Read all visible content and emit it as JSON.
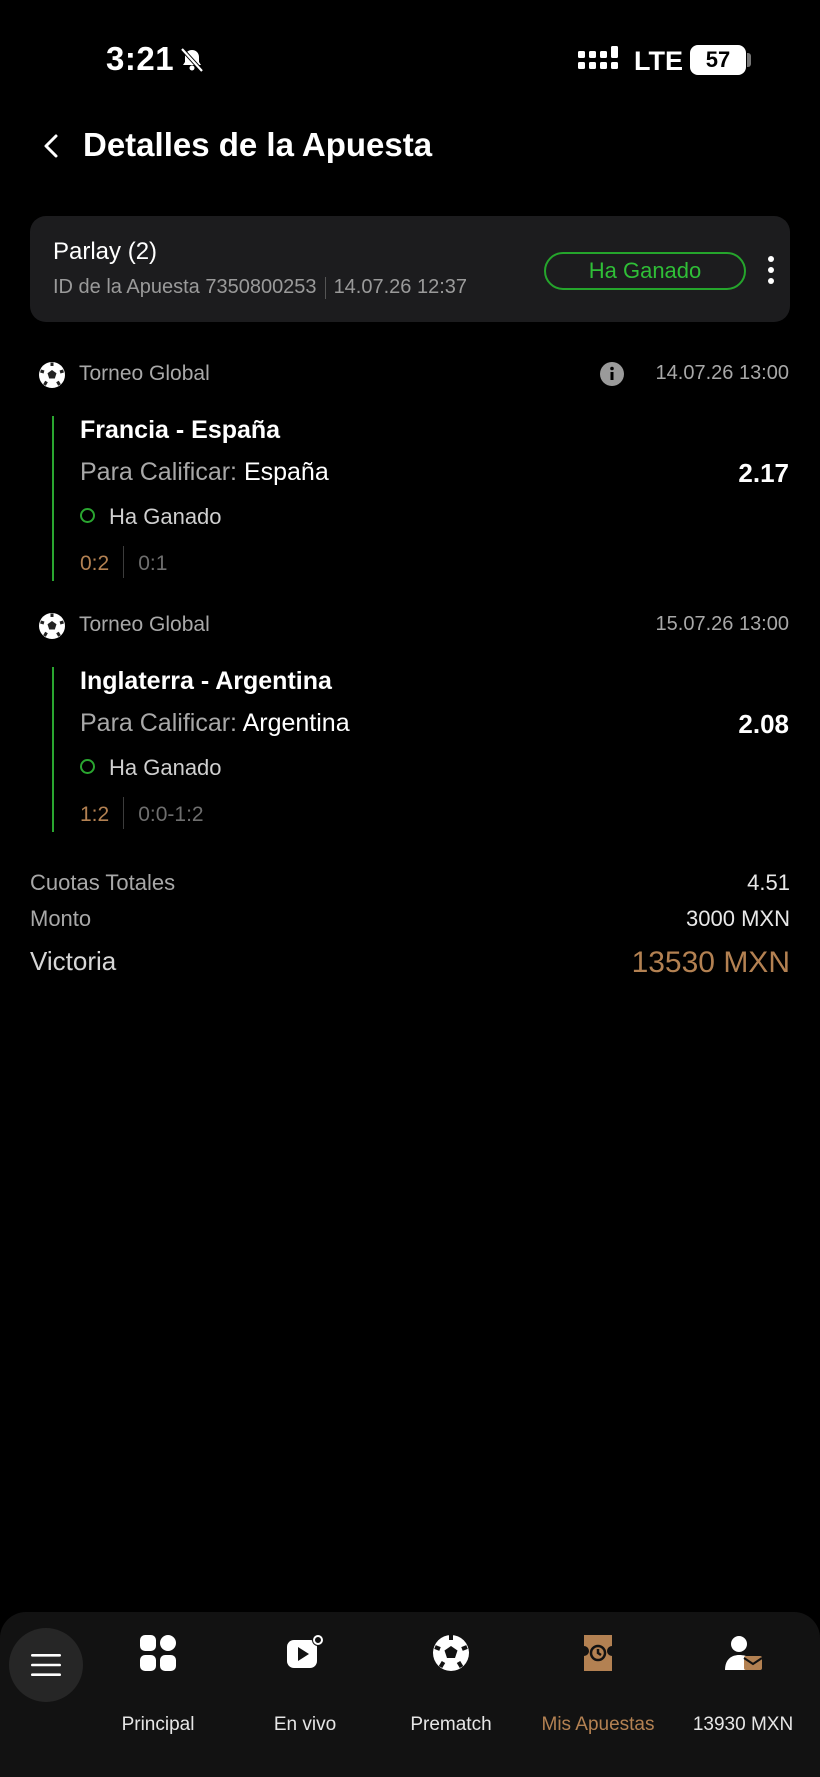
{
  "status_bar": {
    "time": "3:21",
    "network": "LTE",
    "battery": "57"
  },
  "header": {
    "title": "Detalles de la Apuesta"
  },
  "bet": {
    "type": "Parlay (2)",
    "id_text": "ID de la Apuesta 7350800253",
    "datetime": "14.07.26 12:37",
    "status": "Ha Ganado"
  },
  "events": [
    {
      "league": "Torneo Global",
      "date": "14.07.26 13:00",
      "match": "Francia - España",
      "pick_label": "Para Calificar:",
      "pick_team": "España",
      "odds": "2.17",
      "result": "Ha Ganado",
      "score": "0:2",
      "score_detail": "0:1"
    },
    {
      "league": "Torneo Global",
      "date": "15.07.26 13:00",
      "match": "Inglaterra - Argentina",
      "pick_label": "Para Calificar:",
      "pick_team": "Argentina",
      "odds": "2.08",
      "result": "Ha Ganado",
      "score": "1:2",
      "score_detail": "0:0-1:2"
    }
  ],
  "totals": {
    "odds_label": "Cuotas Totales",
    "odds_value": "4.51",
    "amount_label": "Monto",
    "amount_value": "3000 MXN",
    "win_label": "Victoria",
    "win_value": "13530 MXN"
  },
  "nav": {
    "items": [
      {
        "label": "Principal",
        "icon": "grid-icon"
      },
      {
        "label": "En vivo",
        "icon": "live-play-icon"
      },
      {
        "label": "Prematch",
        "icon": "soccer-ball-icon"
      },
      {
        "label": "Mis Apuestas",
        "icon": "ticket-clock-icon",
        "active": true
      },
      {
        "label": "13930 MXN",
        "icon": "user-wallet-icon"
      }
    ]
  },
  "colors": {
    "accent_win": "#2aa630",
    "accent_gold": "#b38152",
    "card_bg": "#1c1c1e"
  }
}
